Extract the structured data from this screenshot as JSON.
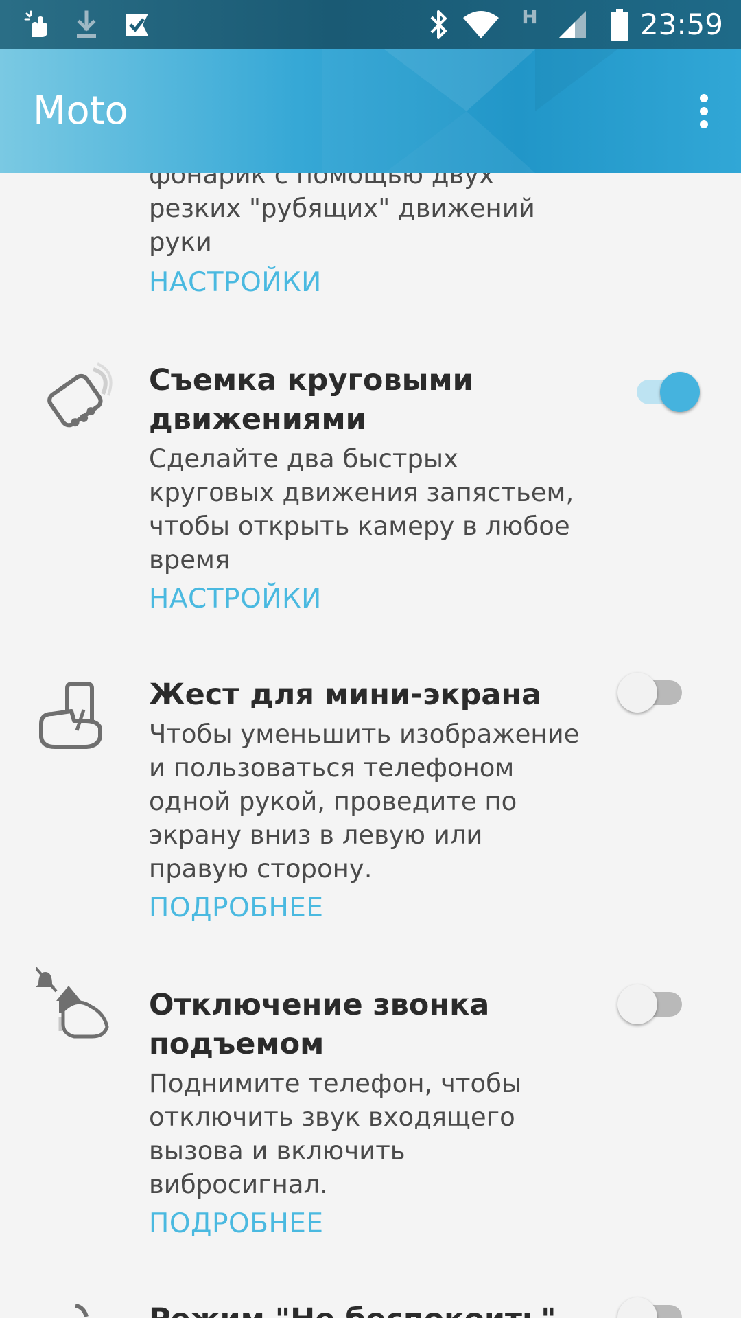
{
  "status_bar": {
    "time": "23:59",
    "network_label": "H",
    "icons": [
      "gesture-notification-icon",
      "download-icon",
      "check-notification-icon",
      "bluetooth-icon",
      "wifi-icon",
      "signal-icon",
      "battery-icon"
    ]
  },
  "app_bar": {
    "title": "Moto",
    "menu_icon": "overflow-menu-icon"
  },
  "partial_item": {
    "desc": "фонарик с помощью двух резких \"рубящих\" движений руки",
    "link": "НАСТРОЙКИ"
  },
  "items": [
    {
      "title": "Съемка круговыми движениями",
      "desc": "Сделайте два быстрых круговых движения запястьем, чтобы открыть камеру в любое время",
      "link": "НАСТРОЙКИ",
      "enabled": true,
      "icon": "twist-camera-icon"
    },
    {
      "title": "Жест для мини-экрана",
      "desc": "Чтобы уменьшить изображение и пользоваться телефоном одной рукой, проведите по экрану вниз в левую или правую сторону.",
      "link": "ПОДРОБНЕЕ",
      "enabled": false,
      "icon": "one-hand-phone-icon"
    },
    {
      "title": "Отключение звонка подъемом",
      "desc": "Поднимите телефон, чтобы отключить звук входящего вызова и включить вибросигнал.",
      "link": "ПОДРОБНЕЕ",
      "enabled": false,
      "icon": "lift-to-silence-icon"
    },
    {
      "title": "Режим \"Не беспокоить\"",
      "enabled": false,
      "icon": "do-not-disturb-icon"
    }
  ],
  "colors": {
    "accent": "#4ab9e0",
    "toggle_on": "#45b3de",
    "app_bar": "#2196c8"
  }
}
